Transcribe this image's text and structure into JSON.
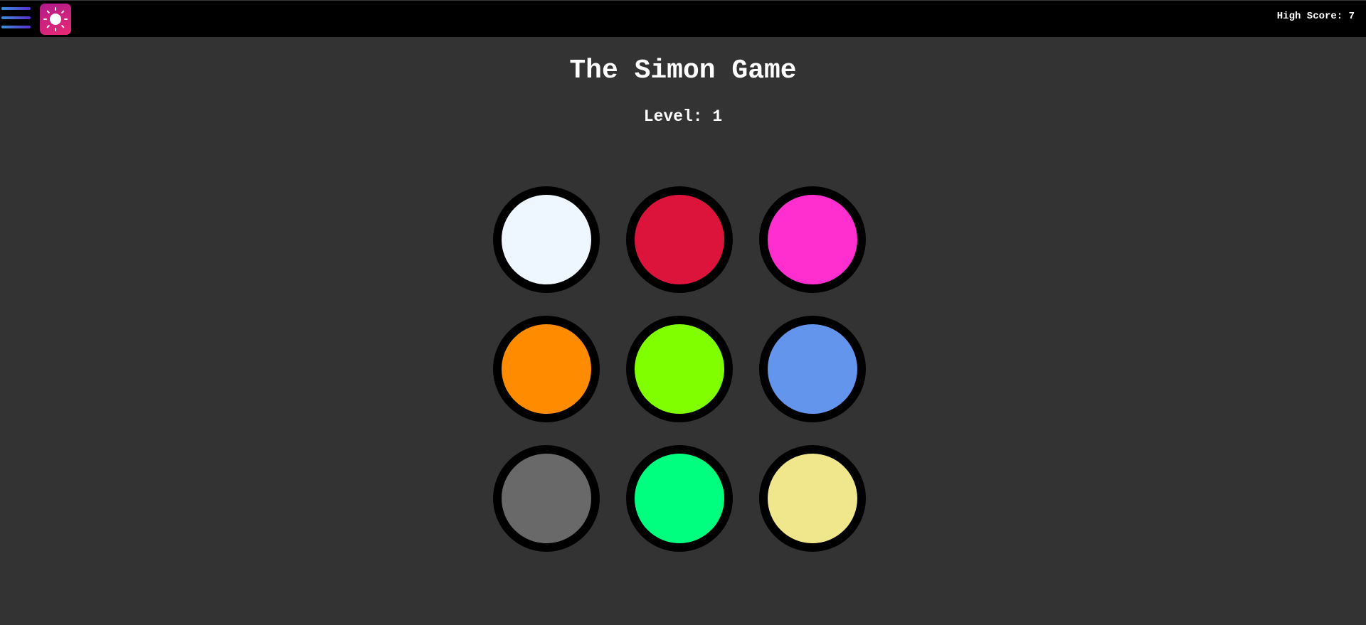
{
  "header": {
    "menu_icon": "hamburger-menu-icon",
    "theme_icon": "sun-icon",
    "high_score_text": "High Score: 7"
  },
  "game": {
    "title": "The Simon Game",
    "level_text": "Level: 1",
    "level": 1,
    "high_score": 7
  },
  "pads": [
    {
      "name": "white-pad",
      "color": "#EEF6FF"
    },
    {
      "name": "crimson-pad",
      "color": "#DC143C"
    },
    {
      "name": "magenta-pad",
      "color": "#FF2ECF"
    },
    {
      "name": "orange-pad",
      "color": "#FF8C00"
    },
    {
      "name": "lime-pad",
      "color": "#7FFF00"
    },
    {
      "name": "blue-pad",
      "color": "#6495ED"
    },
    {
      "name": "gray-pad",
      "color": "#696969"
    },
    {
      "name": "green-pad",
      "color": "#00FF7F"
    },
    {
      "name": "khaki-pad",
      "color": "#F0E68C"
    }
  ],
  "colors": {
    "background": "#333333",
    "topbar": "#000000",
    "pad_border": "#000000",
    "theme_button_gradient": [
      "#B01A8A",
      "#EA2A74"
    ],
    "menu_bar_gradient": [
      "#3A8FD8",
      "#5A2FD0"
    ]
  }
}
